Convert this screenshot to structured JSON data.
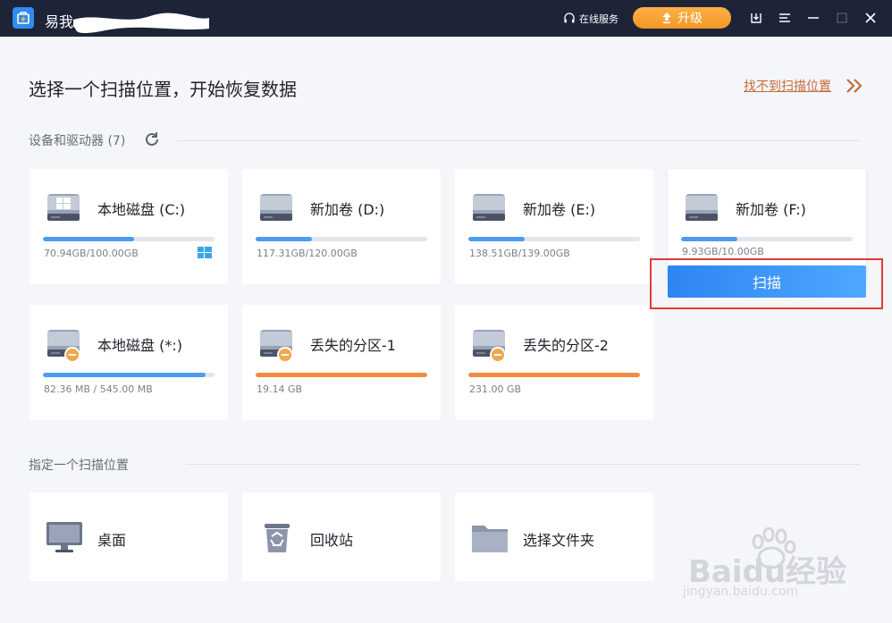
{
  "titlebar": {
    "app_title": "易我",
    "online_service": "在线服务",
    "upgrade_label": "升级"
  },
  "header": {
    "title": "选择一个扫描位置，开始恢复数据",
    "cant_find_link": "找不到扫描位置"
  },
  "devices_section": {
    "title": "设备和驱动器 (7)"
  },
  "drives": [
    {
      "name": "本地磁盘 (C:)",
      "size": "70.94GB/100.00GB",
      "usage": 0.53,
      "icon": "windows-drive-icon",
      "color": "#4a9df0",
      "has_windows_badge": true
    },
    {
      "name": "新加卷 (D:)",
      "size": "117.31GB/120.00GB",
      "usage": 0.33,
      "icon": "hard-drive-icon",
      "color": "#4a9df0"
    },
    {
      "name": "新加卷 (E:)",
      "size": "138.51GB/139.00GB",
      "usage": 0.33,
      "icon": "hard-drive-icon",
      "color": "#4a9df0"
    },
    {
      "name": "新加卷 (F:)",
      "size": "9.93GB/10.00GB",
      "usage": 0.33,
      "icon": "hard-drive-icon",
      "color": "#4a9df0"
    },
    {
      "name": "本地磁盘 (*:)",
      "size": "82.36 MB / 545.00 MB",
      "usage": 0.95,
      "icon": "unallocated-drive-icon",
      "color": "#4a9df0"
    },
    {
      "name": "丢失的分区-1",
      "size": "19.14 GB",
      "usage": 1.0,
      "icon": "lost-partition-icon",
      "color": "#f28b3e"
    },
    {
      "name": "丢失的分区-2",
      "size": "231.00 GB",
      "usage": 1.0,
      "icon": "lost-partition-icon",
      "color": "#f28b3e"
    }
  ],
  "scan_button": "扫描",
  "location_section": {
    "title": "指定一个扫描位置"
  },
  "locations": [
    {
      "name": "桌面",
      "icon": "desktop-icon"
    },
    {
      "name": "回收站",
      "icon": "recycle-bin-icon"
    },
    {
      "name": "选择文件夹",
      "icon": "folder-icon"
    }
  ],
  "watermark": {
    "text": "Baidu经验",
    "sub": "jingyan.baidu.com"
  }
}
